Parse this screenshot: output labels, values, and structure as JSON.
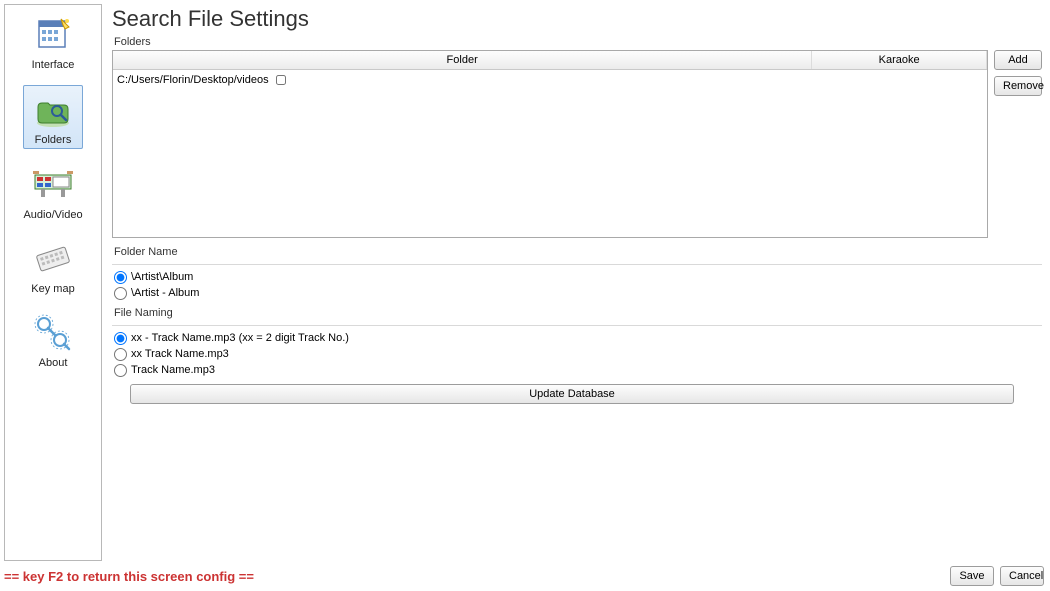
{
  "pageTitle": "Search File Settings",
  "sidebar": {
    "items": [
      {
        "label": "Interface",
        "selected": false
      },
      {
        "label": "Folders",
        "selected": true
      },
      {
        "label": "Audio/Video",
        "selected": false
      },
      {
        "label": "Key map",
        "selected": false
      },
      {
        "label": "About",
        "selected": false
      }
    ]
  },
  "foldersSection": {
    "label": "Folders",
    "columns": {
      "folder": "Folder",
      "karaoke": "Karaoke"
    },
    "rows": [
      {
        "folder": "C:/Users/Florin/Desktop/videos",
        "karaoke": false
      }
    ],
    "addLabel": "Add",
    "removeLabel": "Remove"
  },
  "folderNameSection": {
    "label": "Folder Name",
    "options": [
      {
        "label": "\\Artist\\Album",
        "checked": true
      },
      {
        "label": "\\Artist - Album",
        "checked": false
      }
    ]
  },
  "fileNamingSection": {
    "label": "File Naming",
    "options": [
      {
        "label": "xx - Track Name.mp3 (xx = 2 digit Track No.)",
        "checked": true
      },
      {
        "label": "xx Track Name.mp3",
        "checked": false
      },
      {
        "label": "Track Name.mp3",
        "checked": false
      }
    ]
  },
  "updateButton": "Update Database",
  "footer": {
    "hint": "== key F2 to return this screen config ==",
    "saveLabel": "Save",
    "cancelLabel": "Cancel"
  }
}
